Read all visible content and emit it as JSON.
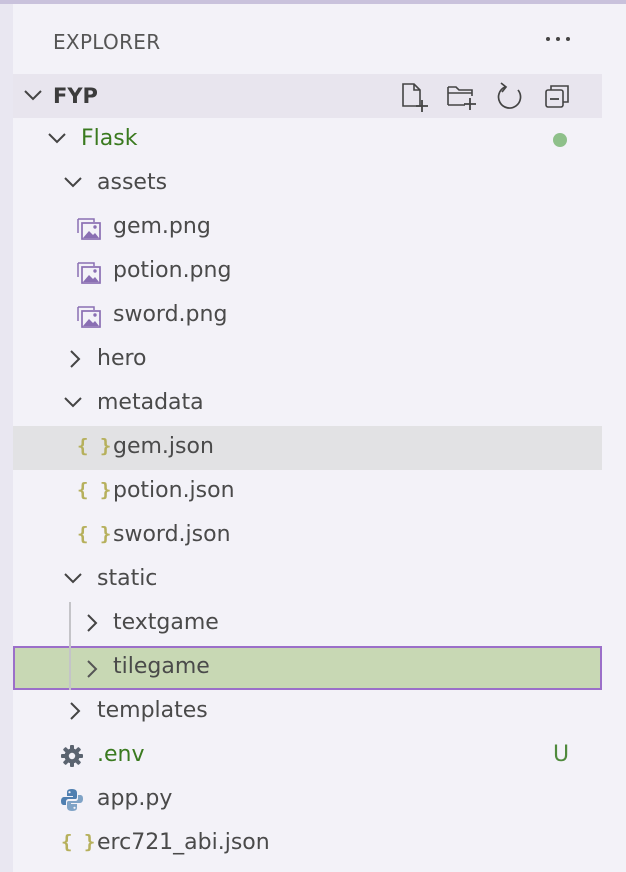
{
  "explorer": {
    "title": "EXPLORER",
    "more_icon": "ellipsis-icon"
  },
  "root": {
    "label": "FYP",
    "actions": [
      "new-file-icon",
      "new-folder-icon",
      "refresh-icon",
      "collapse-all-icon"
    ]
  },
  "tree": {
    "flask": {
      "label": "Flask",
      "status": "modified-dot",
      "color": "#3a7a1f"
    },
    "assets": {
      "label": "assets",
      "children": [
        "gem.png",
        "potion.png",
        "sword.png"
      ]
    },
    "hero": {
      "label": "hero"
    },
    "metadata": {
      "label": "metadata",
      "children": [
        "gem.json",
        "potion.json",
        "sword.json"
      ]
    },
    "static": {
      "label": "static",
      "children": [
        "textgame",
        "tilegame"
      ]
    },
    "templates": {
      "label": "templates"
    },
    "env": {
      "label": ".env",
      "badge": "U",
      "color": "#3a7a1f"
    },
    "app": {
      "label": "app.py"
    },
    "abi": {
      "label": "erc721_abi.json"
    }
  },
  "colors": {
    "selected_bg": "#c8d8b4",
    "selected_border": "#9b6fc9",
    "hover_bg": "#e2e2e4",
    "untracked": "#4f8a3c"
  }
}
